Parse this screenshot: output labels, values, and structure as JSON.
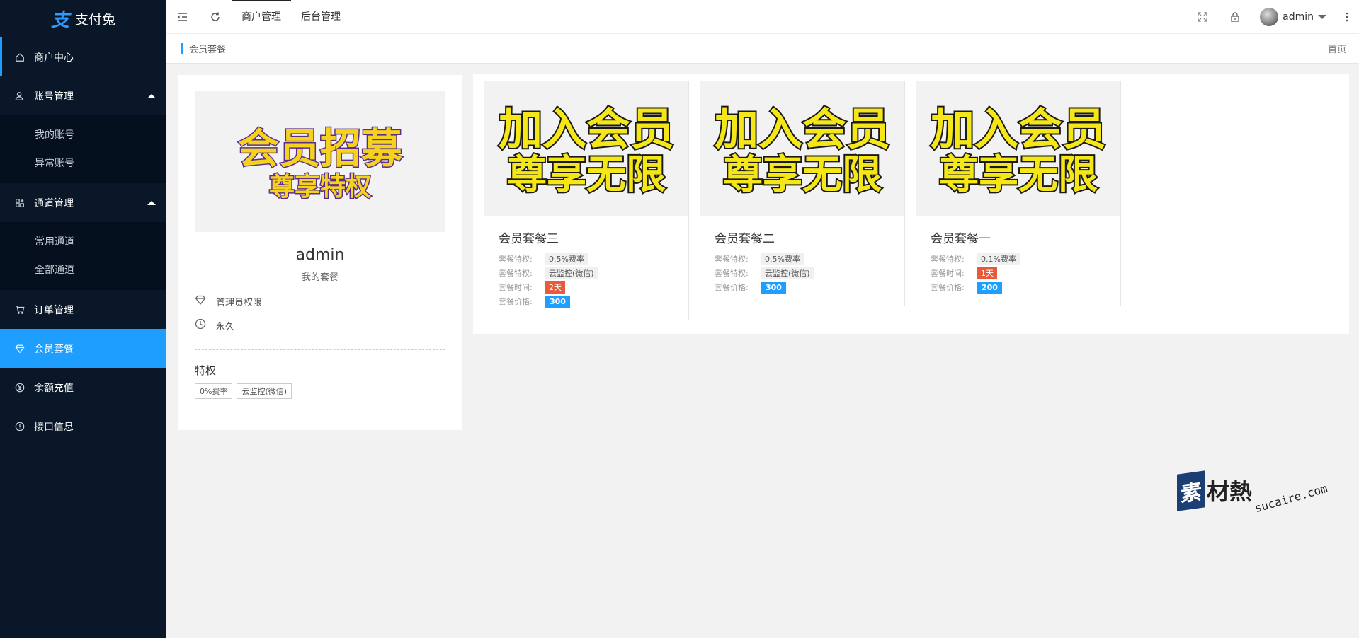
{
  "sidebar": {
    "logo_text": "支付兔",
    "logo_mark": "支",
    "items": [
      {
        "label": "商户中心"
      },
      {
        "label": "账号管理",
        "children": [
          "我的账号",
          "异常账号"
        ]
      },
      {
        "label": "通道管理",
        "children": [
          "常用通道",
          "全部通道"
        ]
      },
      {
        "label": "订单管理"
      },
      {
        "label": "会员套餐"
      },
      {
        "label": "余额充值"
      },
      {
        "label": "接口信息"
      }
    ]
  },
  "header": {
    "links": [
      "商户管理",
      "后台管理"
    ],
    "username": "admin"
  },
  "breadcrumb": {
    "current": "会员套餐",
    "home": "首页"
  },
  "profile": {
    "image_text_top": "会员招募",
    "image_text_bottom": "尊享特权",
    "name": "admin",
    "subtitle": "我的套餐",
    "permission": "管理员权限",
    "duration": "永久",
    "privileges_title": "特权",
    "privilege_tags": [
      "0%费率",
      "云监控(微信)"
    ]
  },
  "packages": [
    {
      "image_top": "加入会员",
      "image_bottom": "尊享无限",
      "title": "会员套餐三",
      "lines": [
        {
          "label": "套餐特权:",
          "value": "0.5%费率",
          "style": "grey"
        },
        {
          "label": "套餐特权:",
          "value": "云监控(微信)",
          "style": "grey"
        },
        {
          "label": "套餐时间:",
          "value": "2天",
          "style": "red"
        },
        {
          "label": "套餐价格:",
          "value": "300",
          "style": "blue"
        }
      ]
    },
    {
      "image_top": "加入会员",
      "image_bottom": "尊享无限",
      "title": "会员套餐二",
      "lines": [
        {
          "label": "套餐特权:",
          "value": "0.5%费率",
          "style": "grey"
        },
        {
          "label": "套餐特权:",
          "value": "云监控(微信)",
          "style": "grey"
        },
        {
          "label": "套餐价格:",
          "value": "300",
          "style": "blue"
        }
      ]
    },
    {
      "image_top": "加入会员",
      "image_bottom": "尊享无限",
      "title": "会员套餐一",
      "lines": [
        {
          "label": "套餐特权:",
          "value": "0.1%费率",
          "style": "grey"
        },
        {
          "label": "套餐时间:",
          "value": "1天",
          "style": "red"
        },
        {
          "label": "套餐价格:",
          "value": "200",
          "style": "blue"
        }
      ]
    }
  ],
  "watermark": {
    "logo": "素",
    "cn": "材熱",
    "url": "sucaire.com"
  },
  "colors": {
    "sidebar_bg": "#0a1728",
    "accent": "#1e9fff",
    "badge_red": "#e85a3a"
  }
}
